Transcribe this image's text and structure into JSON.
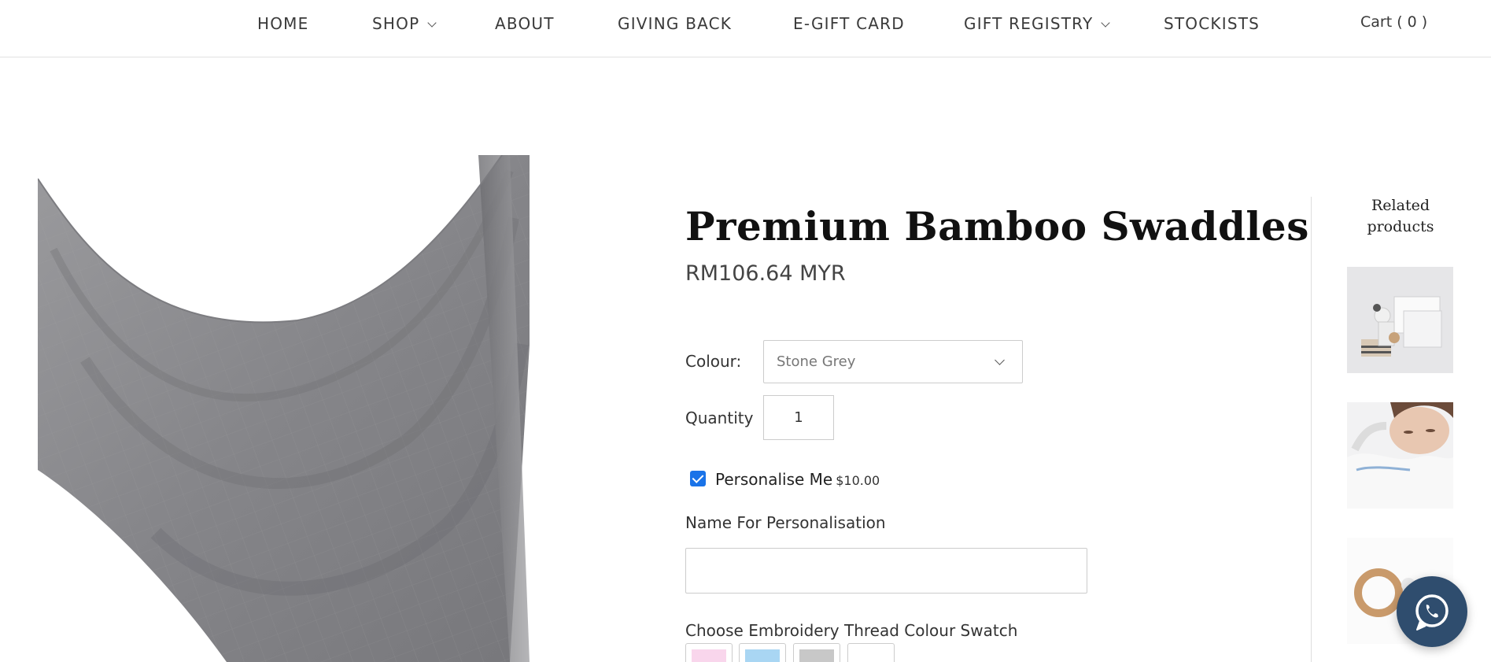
{
  "nav": {
    "items": [
      {
        "label": "HOME"
      },
      {
        "label": "SHOP"
      },
      {
        "label": "ABOUT"
      },
      {
        "label": "GIVING BACK"
      },
      {
        "label": "E-GIFT CARD"
      },
      {
        "label": "GIFT REGISTRY"
      },
      {
        "label": "STOCKISTS"
      }
    ],
    "cart_label": "Cart ( 0 )"
  },
  "product": {
    "title": "Premium Bamboo Swaddles",
    "price": "RM106.64 MYR",
    "colour_label": "Colour:",
    "colour_value": "Stone Grey",
    "quantity_label": "Quantity",
    "quantity_value": "1",
    "personalise_label": "Personalise Me",
    "personalise_fee": "$10.00",
    "personalise_checked": true,
    "name_label": "Name For Personalisation",
    "name_value": "",
    "swatch_label": "Choose Embroidery Thread Colour Swatch",
    "swatches": [
      {
        "color": "#f9d6ec"
      },
      {
        "color": "#a9d6f3"
      },
      {
        "color": "#c8c8c8"
      },
      {
        "color": "#ffffff"
      }
    ]
  },
  "related": {
    "title": "Related products"
  },
  "colors": {
    "accent": "#1a73e8",
    "whatsapp_bg": "#2f4d6e"
  }
}
